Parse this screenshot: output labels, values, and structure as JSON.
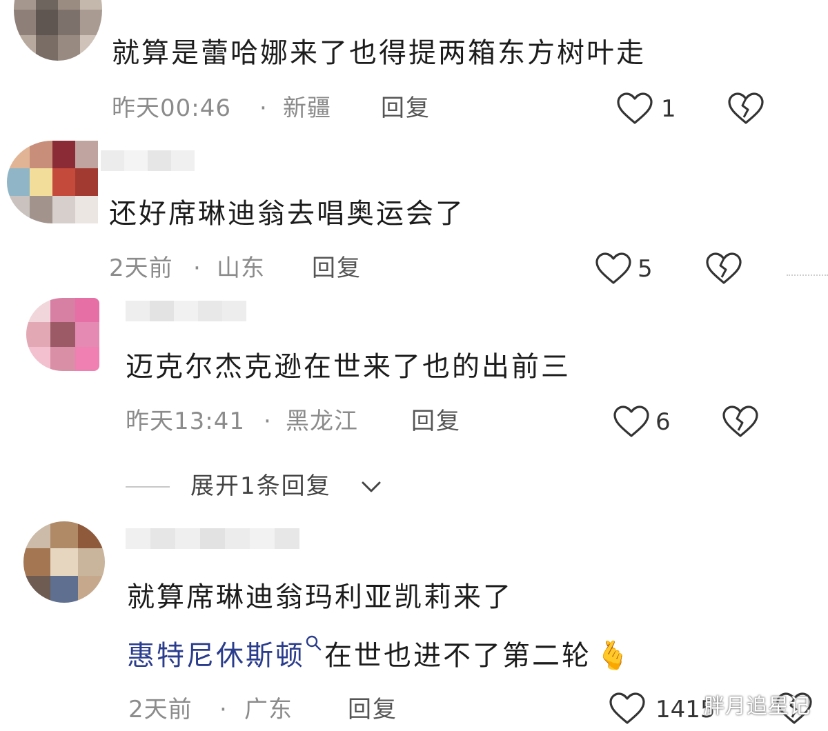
{
  "comments": [
    {
      "text": "就算是蕾哈娜来了也得提两箱东方树叶走",
      "time": "昨天00:46",
      "location": "新疆",
      "reply_label": "回复",
      "likes": "1"
    },
    {
      "text": "还好席琳迪翁去唱奥运会了",
      "time": "2天前",
      "location": "山东",
      "reply_label": "回复",
      "likes": "5"
    },
    {
      "text": "迈克尔杰克逊在世来了也的出前三",
      "time": "昨天13:41",
      "location": "黑龙江",
      "reply_label": "回复",
      "likes": "6",
      "expand_label": "展开1条回复"
    },
    {
      "text_line1": "就算席琳迪翁玛利亚凯莉来了",
      "link_text": "惠特尼休斯顿",
      "text_line2_rest": "在世也进不了第二轮",
      "emoji": "🫰",
      "time": "2天前",
      "location": "广东",
      "reply_label": "回复",
      "likes": "1415"
    }
  ],
  "separator": "·",
  "watermark": "胖月追星记",
  "icons": [
    "heart-icon",
    "broken-heart-icon",
    "search-icon",
    "chevron-down-icon"
  ],
  "colors": {
    "link": "#2a3c8c",
    "meta": "#8b8b8b",
    "text": "#1c1c1c"
  }
}
